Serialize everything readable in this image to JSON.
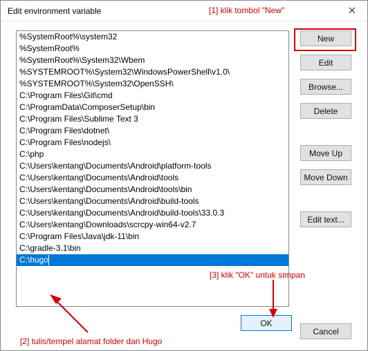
{
  "window": {
    "title": "Edit environment variable"
  },
  "list": {
    "items": [
      "%SystemRoot%\\system32",
      "%SystemRoot%",
      "%SystemRoot%\\System32\\Wbem",
      "%SYSTEMROOT%\\System32\\WindowsPowerShell\\v1.0\\",
      "%SYSTEMROOT%\\System32\\OpenSSH\\",
      "C:\\Program Files\\Git\\cmd",
      "C:\\ProgramData\\ComposerSetup\\bin",
      "C:\\Program Files\\Sublime Text 3",
      "C:\\Program Files\\dotnet\\",
      "C:\\Program Files\\nodejs\\",
      "C:\\php",
      "C:\\Users\\kentang\\Documents\\Android\\platform-tools",
      "C:\\Users\\kentang\\Documents\\Android\\tools",
      "C:\\Users\\kentang\\Documents\\Android\\tools\\bin",
      "C:\\Users\\kentang\\Documents\\Android\\build-tools",
      "C:\\Users\\kentang\\Documents\\Android\\build-tools\\33.0.3",
      "C:\\Users\\kentang\\Downloads\\scrcpy-win64-v2.7",
      "C:\\Program Files\\Java\\jdk-11\\bin",
      "C:\\gradle-3.1\\bin",
      "C:\\hugo"
    ],
    "selected_index": 19
  },
  "buttons": {
    "new": "New",
    "edit": "Edit",
    "browse": "Browse...",
    "delete": "Delete",
    "move_up": "Move Up",
    "move_down": "Move Down",
    "edit_text": "Edit text...",
    "ok": "OK",
    "cancel": "Cancel"
  },
  "annotations": {
    "a1": "[1] klik tombol \"New\"",
    "a2": "[2] tulis/tempel alamat folder dari Hugo",
    "a3": "[3] klik \"OK\" untuk simpan"
  }
}
